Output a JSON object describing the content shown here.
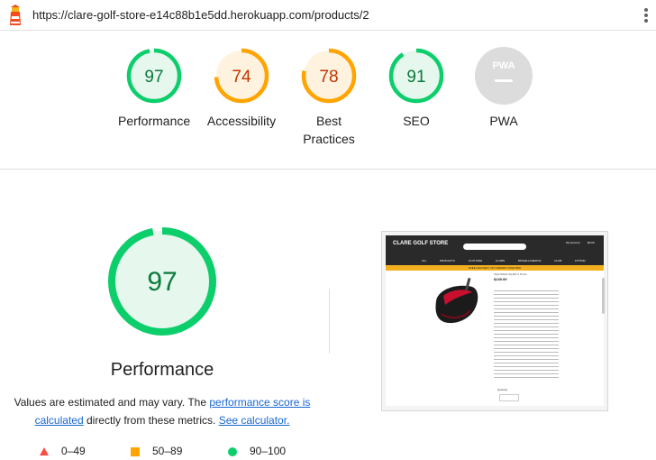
{
  "browser": {
    "url": "https://clare-golf-store-e14c88b1e5dd.herokuapp.com/products/2"
  },
  "colors": {
    "pass": "#0cce6b",
    "pass_bg": "#e6f7ed",
    "pass_text": "#0a7a3d",
    "average": "#ffa400",
    "average_bg": "#fff3e0",
    "average_text": "#c33300",
    "fail": "#ff4e42",
    "na": "#dcdcdc"
  },
  "categories": [
    {
      "score": 97,
      "label": "Performance",
      "rating": "pass"
    },
    {
      "score": 74,
      "label": "Accessibility",
      "rating": "average"
    },
    {
      "score": 78,
      "label": "Best Practices",
      "rating": "average"
    },
    {
      "score": 91,
      "label": "SEO",
      "rating": "pass"
    },
    {
      "score": null,
      "label": "PWA",
      "badge": "PWA",
      "rating": "na"
    }
  ],
  "main": {
    "score": 97,
    "title": "Performance",
    "note_a": "Values are estimated and may vary. The ",
    "note_link1": "performance score is calculated",
    "note_b": " directly from these metrics. ",
    "note_link2": "See calculator."
  },
  "legend": [
    {
      "range": "0–49",
      "shape": "triangle"
    },
    {
      "range": "50–89",
      "shape": "square"
    },
    {
      "range": "90–100",
      "shape": "circle"
    }
  ],
  "preview": {
    "brand": "CLARE GOLF STORE",
    "account": "My Account",
    "bag": "$0.00",
    "menu": "ALL PRODUCTS CLOTHING CLUBS MISCELLANEOUS CLUB FITTING",
    "banner": "FREE DELIVERY ON ORDERS OVER $50!",
    "product_title": "TaylorMade Stealth 2 Driver",
    "price": "$249.99",
    "quantity": "Quantity"
  }
}
